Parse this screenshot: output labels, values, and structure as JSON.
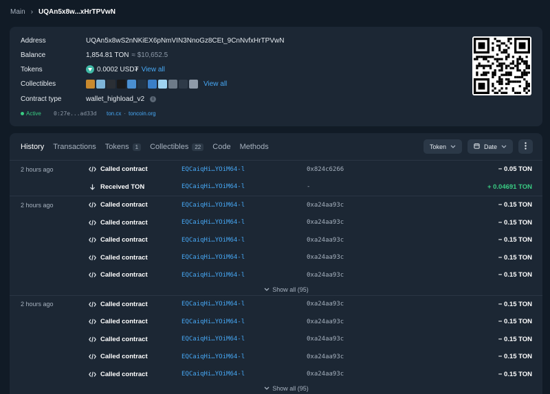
{
  "breadcrumb": {
    "main": "Main",
    "current": "UQAn5x8w...xHrTPVwN"
  },
  "account": {
    "address_label": "Address",
    "address": "UQAn5x8wS2nNKiEX6pNmVIN3NnoGz8CEt_9CnNvfxHrTPVwN",
    "balance_label": "Balance",
    "balance": "1,854.81 TON",
    "balance_fiat": "≈ $10,652.5",
    "tokens_label": "Tokens",
    "tokens_value": "0.0002 USD₮",
    "view_all": "View all",
    "collectibles_label": "Collectibles",
    "collectibles_view_all": "View all",
    "collectible_colors": [
      "#c98a2e",
      "#7fb5d8",
      "#2a2f35",
      "#1a1a1a",
      "#4a8fd0",
      "#223344",
      "#3a7fc8",
      "#9fd3f0",
      "#6d7a88",
      "#2e3a48",
      "#8e9aa8"
    ],
    "contract_label": "Contract type",
    "contract_type": "wallet_highload_v2",
    "status": "Active",
    "code_hash": "0:27e...ad33d",
    "link_tonscan": "ton.cx",
    "link_sep": "·",
    "link_toncoin": "toncoin.org"
  },
  "tabs": [
    {
      "label": "History",
      "active": true
    },
    {
      "label": "Transactions"
    },
    {
      "label": "Tokens",
      "count": "1"
    },
    {
      "label": "Collectibles",
      "count": "22"
    },
    {
      "label": "Code"
    },
    {
      "label": "Methods"
    }
  ],
  "filters": {
    "token": "Token",
    "date": "Date"
  },
  "groups": [
    {
      "time": "2 hours ago",
      "rows": [
        {
          "icon": "code",
          "action": "Called contract",
          "address": "EQCaiqHi…YOiM64-l",
          "op": "0x824c6266",
          "amount": "− 0.05 TON",
          "positive": false
        },
        {
          "icon": "arrow-down",
          "action": "Received TON",
          "address": "EQCaiqHi…YOiM64-l",
          "op": "-",
          "amount": "+ 0.04691 TON",
          "positive": true
        }
      ]
    },
    {
      "time": "2 hours ago",
      "rows": [
        {
          "icon": "code",
          "action": "Called contract",
          "address": "EQCaiqHi…YOiM64-l",
          "op": "0xa24aa93c",
          "amount": "− 0.15 TON",
          "positive": false
        },
        {
          "icon": "code",
          "action": "Called contract",
          "address": "EQCaiqHi…YOiM64-l",
          "op": "0xa24aa93c",
          "amount": "− 0.15 TON",
          "positive": false
        },
        {
          "icon": "code",
          "action": "Called contract",
          "address": "EQCaiqHi…YOiM64-l",
          "op": "0xa24aa93c",
          "amount": "− 0.15 TON",
          "positive": false
        },
        {
          "icon": "code",
          "action": "Called contract",
          "address": "EQCaiqHi…YOiM64-l",
          "op": "0xa24aa93c",
          "amount": "− 0.15 TON",
          "positive": false
        },
        {
          "icon": "code",
          "action": "Called contract",
          "address": "EQCaiqHi…YOiM64-l",
          "op": "0xa24aa93c",
          "amount": "− 0.15 TON",
          "positive": false
        }
      ],
      "show_all": "Show all (95)"
    },
    {
      "time": "2 hours ago",
      "rows": [
        {
          "icon": "code",
          "action": "Called contract",
          "address": "EQCaiqHi…YOiM64-l",
          "op": "0xa24aa93c",
          "amount": "− 0.15 TON",
          "positive": false
        },
        {
          "icon": "code",
          "action": "Called contract",
          "address": "EQCaiqHi…YOiM64-l",
          "op": "0xa24aa93c",
          "amount": "− 0.15 TON",
          "positive": false
        },
        {
          "icon": "code",
          "action": "Called contract",
          "address": "EQCaiqHi…YOiM64-l",
          "op": "0xa24aa93c",
          "amount": "− 0.15 TON",
          "positive": false
        },
        {
          "icon": "code",
          "action": "Called contract",
          "address": "EQCaiqHi…YOiM64-l",
          "op": "0xa24aa93c",
          "amount": "− 0.15 TON",
          "positive": false
        },
        {
          "icon": "code",
          "action": "Called contract",
          "address": "EQCaiqHi…YOiM64-l",
          "op": "0xa24aa93c",
          "amount": "− 0.15 TON",
          "positive": false
        }
      ],
      "show_all": "Show all (95)"
    }
  ]
}
